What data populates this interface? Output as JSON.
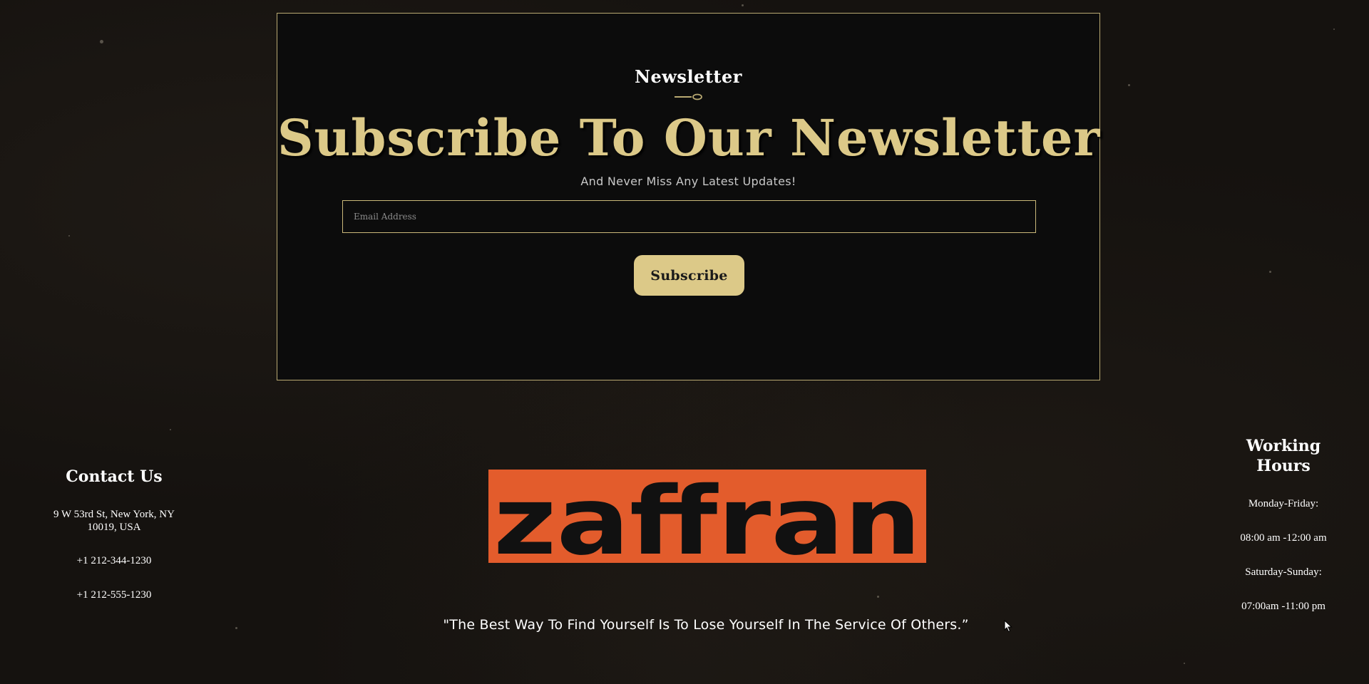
{
  "newsletter": {
    "eyebrow": "Newsletter",
    "title": "Subscribe To Our Newsletter",
    "subtitle": "And Never Miss Any Latest Updates!",
    "email_placeholder": "Email Address",
    "email_value": "",
    "subscribe_label": "Subscribe"
  },
  "contact": {
    "heading": "Contact Us",
    "address": "9 W 53rd St, New York, NY 10019, USA",
    "phone_1": "+1 212-344-1230",
    "phone_2": "+1 212-555-1230"
  },
  "logo": {
    "text": "zaffran",
    "icon": "zaffran-logo"
  },
  "quote": "\"The Best Way To Find Yourself Is To Lose Yourself In The Service Of Others.”",
  "hours": {
    "heading": "Working Hours",
    "weekday_label": "Monday-Friday:",
    "weekday_time": "08:00 am -12:00 am",
    "weekend_label": "Saturday-Sunday:",
    "weekend_time": "07:00am -11:00 pm"
  },
  "colors": {
    "accent_gold": "#dcc988",
    "logo_orange": "#e35c2c",
    "card_background": "#0c0c0c"
  }
}
